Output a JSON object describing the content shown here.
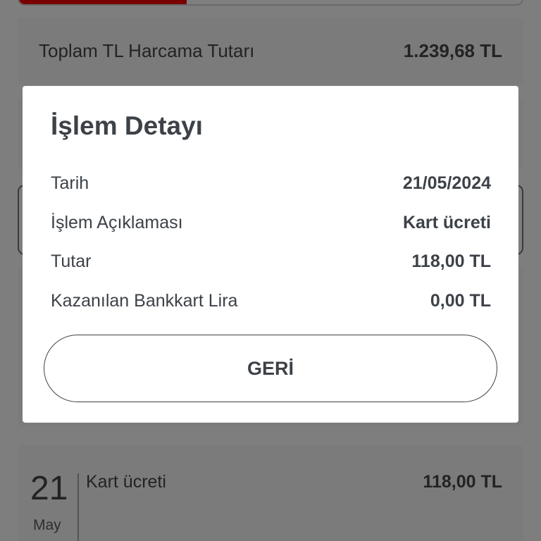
{
  "background": {
    "summary": {
      "label": "Toplam TL Harcama Tutarı",
      "value": "1.239,68 TL"
    },
    "transaction": {
      "day": "21",
      "month": "May",
      "description": "Kart ücreti",
      "amount": "118,00 TL"
    }
  },
  "modal": {
    "title": "İşlem Detayı",
    "rows": [
      {
        "label": "Tarih",
        "value": "21/05/2024"
      },
      {
        "label": "İşlem Açıklaması",
        "value": "Kart ücreti"
      },
      {
        "label": "Tutar",
        "value": "118,00 TL"
      },
      {
        "label": "Kazanılan Bankkart Lira",
        "value": "0,00 TL"
      }
    ],
    "back_label": "GERİ"
  }
}
